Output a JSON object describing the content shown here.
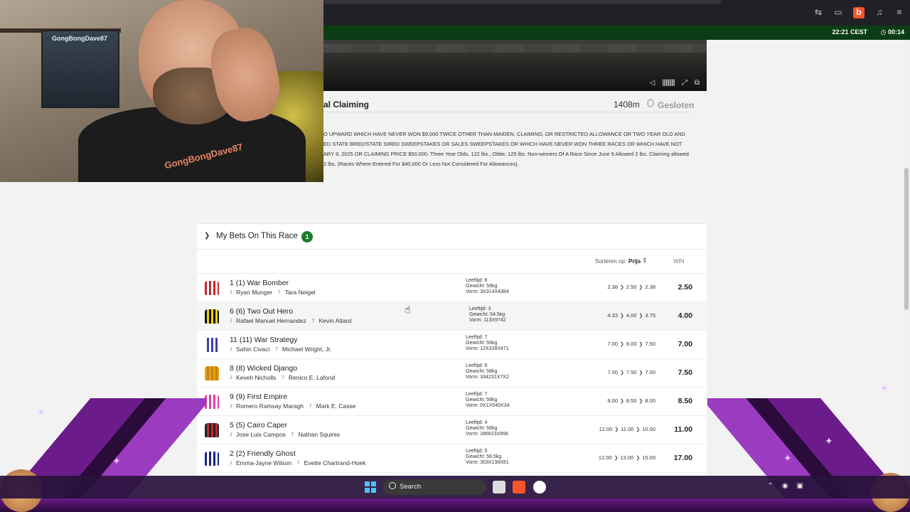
{
  "browser": {
    "clock": "22:21 CEST",
    "timer": "◷ 00:14"
  },
  "race": {
    "title": "al Claiming",
    "distance": "1408m",
    "status": "Gesloten",
    "conditions": "O UPWARD WHICH HAVE NEVER WON $9,000 TWICE OTHER THAN MAIDEN, CLAIMING, OR RESTRICTED ALLOWANCE OR TWO YEAR OLD AND ED STATE BRED/STATE SIRED SWEEPSTAKES OR SALES SWEEPSTAKES OR WHICH HAVE NEVER WON THREE RACES OR WHICH HAVE NOT ARY 9, 2025 OR CLAIMING PRICE $50,000. Three Year Olds, 122 lbs.; Older, 125 lbs. Non-winners Of A Race Since June 9 Allowed 2 lbs. Claiming allowed 2 lbs. (Races Where Entered For $40,000 Or Less Not Considered For Allowances)."
  },
  "webcam": {
    "poster_name": "GongBongDave87",
    "shirt_text": "GongBongDave87"
  },
  "mybets": {
    "label": "My Bets On This Race",
    "count": "1"
  },
  "sort": {
    "label": "Sorteren op:",
    "value": "Prijs",
    "win_header": "WIN"
  },
  "runners": [
    {
      "name": "1 (1) War Bomber",
      "jockey": "Ryan Munger",
      "trainer": "Tara Neigel",
      "age": "Leeftijd: 8",
      "weight": "Gewicht: 56kg",
      "form": "Vorm: 3X314X4384",
      "h1": "2.38",
      "h2": "2.50",
      "h3": "2.38",
      "win": "2.50",
      "silk": [
        "#c0272d",
        "#ffffff"
      ]
    },
    {
      "name": "6 (6) Two Out Hero",
      "jockey": "Rafael Manuel Hernandez",
      "trainer": "Kevin Attard",
      "age": "Leeftijd: 3",
      "weight": "Gewicht: 54.5kg",
      "form": "Vorm: 113X9742",
      "h1": "4.33",
      "h2": "4.00",
      "h3": "3.75",
      "win": "4.00",
      "silk": [
        "#111111",
        "#f2d200"
      ]
    },
    {
      "name": "11 (11) War Strategy",
      "jockey": "Sahin Civaci",
      "trainer": "Michael Wright, Jr.",
      "age": "Leeftijd: 7",
      "weight": "Gewicht: 56kg",
      "form": "Vorm: 12X328X471",
      "h1": "7.00",
      "h2": "8.00",
      "h3": "7.50",
      "win": "7.00",
      "silk": [
        "#ffffff",
        "#3a3fb0"
      ]
    },
    {
      "name": "8 (8) Wicked Django",
      "jockey": "Keveh Nicholls",
      "trainer": "Renico E. Lafond",
      "age": "Leeftijd: 6",
      "weight": "Gewicht: 56kg",
      "form": "Vorm: 334231X7X2",
      "h1": "7.00",
      "h2": "7.50",
      "h3": "7.00",
      "win": "7.50",
      "silk": [
        "#e6a21a",
        "#c58310"
      ]
    },
    {
      "name": "9 (9) First Empire",
      "jockey": "Romero Ramsay Maragh",
      "trainer": "Mark E. Casse",
      "age": "Leeftijd: 7",
      "weight": "Gewicht: 56kg",
      "form": "Vorm: 0X1X540X34",
      "h1": "9.00",
      "h2": "8.50",
      "h3": "8.00",
      "win": "8.50",
      "silk": [
        "#e0409a",
        "#ffffff"
      ]
    },
    {
      "name": "5 (5) Cairo Caper",
      "jockey": "Jose Luis Campos",
      "trainer": "Nathan Squires",
      "age": "Leeftijd: 4",
      "weight": "Gewicht: 56kg",
      "form": "Vorm: 286623X856",
      "h1": "12.00",
      "h2": "11.00",
      "h3": "10.00",
      "win": "11.00",
      "silk": [
        "#222222",
        "#c0272d"
      ]
    },
    {
      "name": "2 (2) Friendly Ghost",
      "jockey": "Emma-Jayne Wilson",
      "trainer": "Evette Chartrand-Hoek",
      "age": "Leeftijd: 5",
      "weight": "Gewicht: 56.5kg",
      "form": "Vorm: 303X138X81",
      "h1": "12.00",
      "h2": "13.00",
      "h3": "15.00",
      "win": "17.00",
      "silk": [
        "#1a237e",
        "#ffffff"
      ]
    }
  ],
  "tags": {
    "jockey": "J",
    "trainer": "T"
  },
  "taskbar": {
    "search_label": "Search"
  }
}
